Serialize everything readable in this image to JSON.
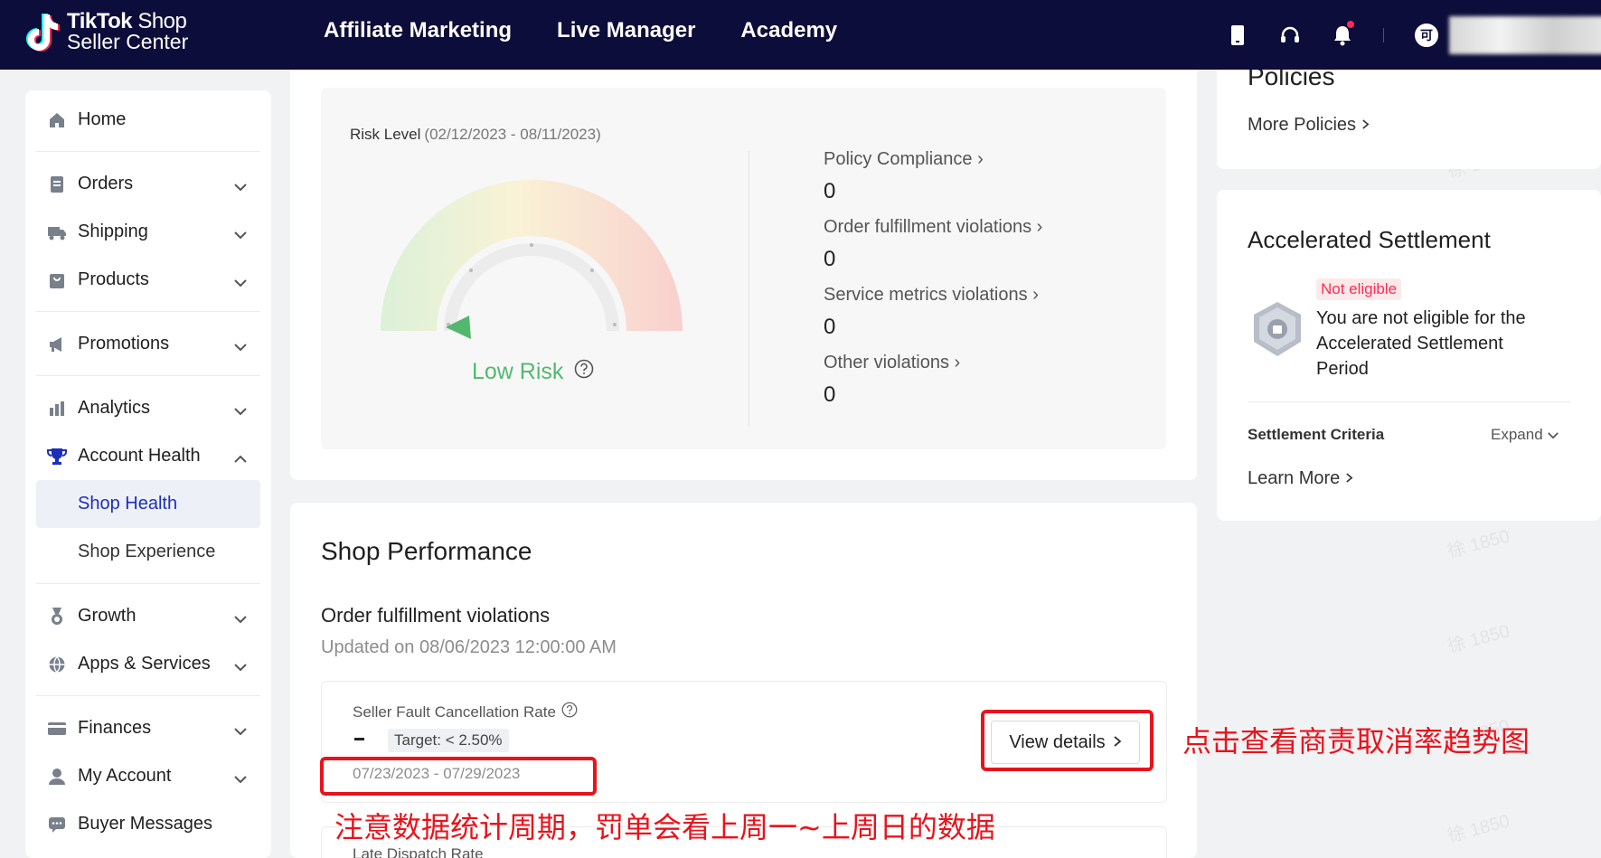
{
  "topbar": {
    "logo_line1_bold": "TikTok",
    "logo_line1_rest": "Shop",
    "logo_line2": "Seller Center",
    "nav": [
      "Affiliate Marketing",
      "Live Manager",
      "Academy"
    ],
    "icons": [
      "mobile-icon",
      "headset-icon",
      "bell-icon"
    ],
    "avatar_text": "可"
  },
  "sidebar": {
    "items": [
      {
        "label": "Home",
        "icon": "home-icon"
      },
      {
        "label": "Orders",
        "icon": "orders-icon"
      },
      {
        "label": "Shipping",
        "icon": "truck-icon"
      },
      {
        "label": "Products",
        "icon": "bag-icon"
      },
      {
        "label": "Promotions",
        "icon": "megaphone-icon"
      },
      {
        "label": "Analytics",
        "icon": "bar-chart-icon"
      },
      {
        "label": "Account Health",
        "icon": "trophy-icon"
      },
      {
        "label": "Shop Health"
      },
      {
        "label": "Shop Experience"
      },
      {
        "label": "Growth",
        "icon": "medal-icon"
      },
      {
        "label": "Apps & Services",
        "icon": "globe-icon"
      },
      {
        "label": "Finances",
        "icon": "card-icon"
      },
      {
        "label": "My Account",
        "icon": "user-icon"
      },
      {
        "label": "Buyer Messages",
        "icon": "chat-icon"
      }
    ]
  },
  "risk": {
    "title": "Risk Level",
    "range": "(02/12/2023 - 08/11/2023)",
    "level": "Low Risk",
    "violations": [
      {
        "label": "Policy Compliance",
        "value": "0"
      },
      {
        "label": "Order fulfillment violations",
        "value": "0"
      },
      {
        "label": "Service metrics violations",
        "value": "0"
      },
      {
        "label": "Other violations",
        "value": "0"
      }
    ]
  },
  "performance": {
    "title": "Shop Performance",
    "subtitle": "Order fulfillment violations",
    "updated": "Updated on 08/06/2023 12:00:00 AM",
    "metric_title": "Seller Fault Cancellation Rate",
    "metric_value": "-",
    "target": "Target: < 2.50%",
    "date_range": "07/23/2023 - 07/29/2023",
    "view_details": "View details",
    "metric2_title": "Late Dispatch Rate"
  },
  "policies": {
    "title": "Policies",
    "more": "More Policies"
  },
  "settlement": {
    "title": "Accelerated Settlement",
    "status": "Not eligible",
    "message": "You are not eligible for the Accelerated Settlement Period",
    "criteria": "Settlement Criteria",
    "expand": "Expand",
    "learn_more": "Learn More"
  },
  "annotations": {
    "view_details_note": "点击查看商责取消率趋势图",
    "date_note": "注意数据统计周期，罚单会看上周一~上周日的数据"
  },
  "watermark": "徐 1850",
  "colors": {
    "topbar": "#0c0d3a",
    "active": "#1c2fb8",
    "low_risk": "#52b86e",
    "annotation": "#e8131b",
    "not_eligible": "#fe2c55"
  }
}
